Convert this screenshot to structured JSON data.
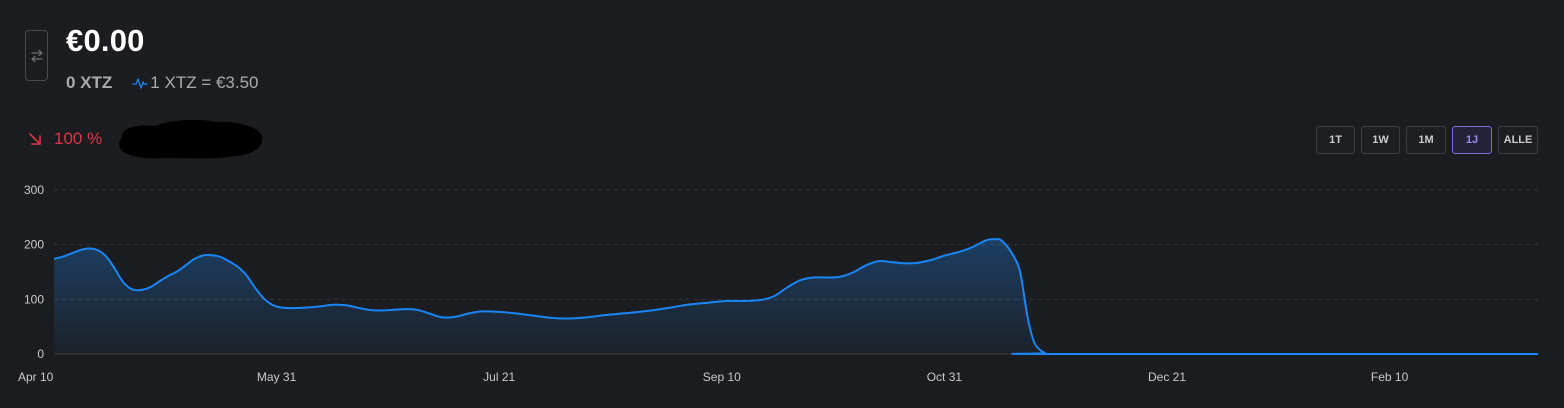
{
  "wallet": {
    "balance_fiat": "€0.00",
    "balance_token": "0 XTZ",
    "rate_text": "1 XTZ = €3.50",
    "change_text": "100 %"
  },
  "icons": {
    "swap": "swap-arrows-icon",
    "rate": "pulse-icon",
    "change": "arrow-down-right-icon"
  },
  "range_buttons": [
    {
      "label": "1T",
      "active": false
    },
    {
      "label": "1W",
      "active": false
    },
    {
      "label": "1M",
      "active": false
    },
    {
      "label": "1J",
      "active": true
    },
    {
      "label": "ALLE",
      "active": false
    }
  ],
  "colors": {
    "background": "#1c1d20",
    "line": "#1a86f5",
    "negative": "#e0344a",
    "active_range": "#7c6fd8"
  },
  "chart_data": {
    "type": "area",
    "x_ticks": [
      "Apr 10",
      "May 31",
      "Jul 21",
      "Sep 10",
      "Oct 31",
      "Dec 21",
      "Feb 10"
    ],
    "x_tick_days": [
      0,
      51,
      102,
      153,
      204,
      255,
      306
    ],
    "y_ticks": [
      0,
      100,
      200,
      300
    ],
    "ylim": [
      0,
      300
    ],
    "xlim": [
      0,
      340
    ],
    "grid": true,
    "points": [
      [
        0,
        174
      ],
      [
        2,
        178
      ],
      [
        4,
        184
      ],
      [
        6,
        190
      ],
      [
        8,
        193
      ],
      [
        10,
        190
      ],
      [
        12,
        178
      ],
      [
        14,
        155
      ],
      [
        16,
        130
      ],
      [
        18,
        118
      ],
      [
        20,
        117
      ],
      [
        22,
        122
      ],
      [
        24,
        132
      ],
      [
        26,
        142
      ],
      [
        28,
        150
      ],
      [
        30,
        161
      ],
      [
        32,
        173
      ],
      [
        34,
        180
      ],
      [
        36,
        181
      ],
      [
        38,
        178
      ],
      [
        40,
        170
      ],
      [
        42,
        160
      ],
      [
        44,
        145
      ],
      [
        46,
        122
      ],
      [
        48,
        102
      ],
      [
        50,
        90
      ],
      [
        52,
        85
      ],
      [
        55,
        84
      ],
      [
        58,
        85
      ],
      [
        61,
        87
      ],
      [
        64,
        90
      ],
      [
        67,
        89
      ],
      [
        70,
        84
      ],
      [
        73,
        80
      ],
      [
        76,
        80
      ],
      [
        80,
        82
      ],
      [
        83,
        81
      ],
      [
        86,
        74
      ],
      [
        89,
        67
      ],
      [
        92,
        68
      ],
      [
        95,
        74
      ],
      [
        98,
        78
      ],
      [
        102,
        77
      ],
      [
        106,
        74
      ],
      [
        110,
        70
      ],
      [
        114,
        66
      ],
      [
        118,
        65
      ],
      [
        122,
        67
      ],
      [
        126,
        71
      ],
      [
        130,
        74
      ],
      [
        134,
        77
      ],
      [
        138,
        81
      ],
      [
        142,
        86
      ],
      [
        146,
        91
      ],
      [
        150,
        94
      ],
      [
        154,
        97
      ],
      [
        158,
        97
      ],
      [
        162,
        99
      ],
      [
        165,
        106
      ],
      [
        168,
        122
      ],
      [
        171,
        135
      ],
      [
        174,
        140
      ],
      [
        177,
        140
      ],
      [
        180,
        141
      ],
      [
        183,
        149
      ],
      [
        186,
        162
      ],
      [
        189,
        170
      ],
      [
        192,
        168
      ],
      [
        195,
        166
      ],
      [
        198,
        167
      ],
      [
        201,
        172
      ],
      [
        204,
        180
      ],
      [
        207,
        186
      ],
      [
        210,
        194
      ],
      [
        212,
        202
      ],
      [
        214,
        209
      ],
      [
        216,
        210
      ],
      [
        217,
        208
      ],
      [
        219,
        190
      ],
      [
        221,
        160
      ],
      [
        222,
        120
      ],
      [
        223,
        70
      ],
      [
        224,
        35
      ],
      [
        225,
        15
      ],
      [
        227,
        2
      ],
      [
        229,
        0
      ],
      [
        340,
        0
      ]
    ]
  }
}
